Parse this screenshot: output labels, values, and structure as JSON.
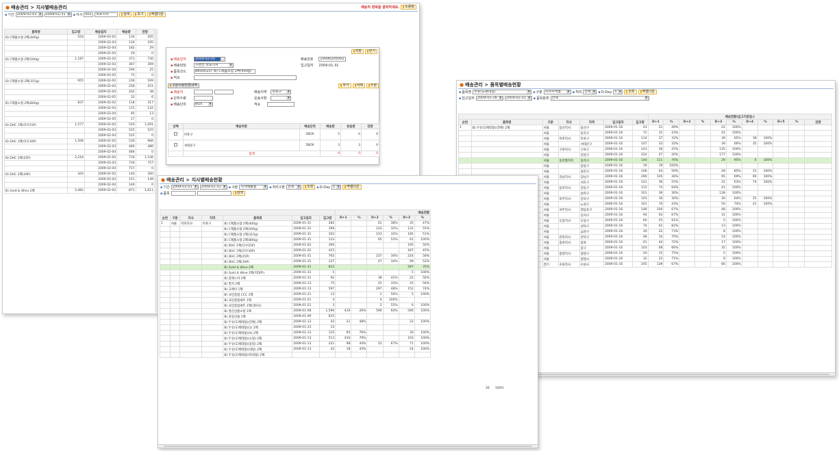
{
  "w1": {
    "title": "배송관리 > 지사별배송관리",
    "notice": "배송처 항목을 클릭하세요.",
    "notice_btn": "도움말",
    "filter_period_label": "기간",
    "date_from": "2009-01-01",
    "date_to": "2009-01-31",
    "branch_label": "지사",
    "branch_code": "001",
    "branch_name": "마포지사",
    "btn_query": "검색",
    "btn_reset": "초기",
    "btn_excel": "엑셀다운",
    "columns": [
      "품목명",
      "입고량",
      "배송일자",
      "배송량",
      "잔량"
    ],
    "rows": [
      [
        "B) C제품소형 2팩(400g)",
        "554",
        "2009-02-02",
        "134",
        "205"
      ],
      [
        "",
        "",
        "2009-02-03",
        "134",
        "105"
      ],
      [
        "",
        "",
        "2009-02-04",
        "182",
        "29"
      ],
      [
        "",
        "",
        "2009-02-05",
        "29",
        "0"
      ],
      [
        "B) C제품소형 2팩(500g)",
        "1,187",
        "2009-02-02",
        "371",
        "736"
      ],
      [
        "",
        "",
        "2009-02-03",
        "367",
        "369"
      ],
      [
        "",
        "",
        "2009-02-04",
        "290",
        "25"
      ],
      [
        "",
        "",
        "2009-02-05",
        "75",
        "0"
      ],
      [
        "B) C제품소형 2팩(315g)",
        "955",
        "2009-02-02",
        "236",
        "509"
      ],
      [
        "",
        "",
        "2009-02-03",
        "258",
        "251"
      ],
      [
        "",
        "",
        "2009-02-04",
        "202",
        "38"
      ],
      [
        "",
        "",
        "2009-02-05",
        "32",
        "6"
      ],
      [
        "B) C제품소형 2팩(800g)",
        "837",
        "2009-02-02",
        "118",
        "317"
      ],
      [
        "",
        "",
        "2009-02-03",
        "115",
        "132"
      ],
      [
        "",
        "",
        "2009-02-04",
        "95",
        "13"
      ],
      [
        "",
        "",
        "2009-02-05",
        "17",
        "0"
      ],
      [
        "B) DHC 1팩(다우25P)",
        "1,577",
        "2009-02-02",
        "520",
        "1,001"
      ],
      [
        "",
        "",
        "2009-02-03",
        "525",
        "525"
      ],
      [
        "",
        "",
        "2009-02-04",
        "525",
        "0"
      ],
      [
        "B) DHC 1팩(다우30P)",
        "1,506",
        "2009-02-02",
        "530",
        "966"
      ],
      [
        "",
        "",
        "2009-02-03",
        "480",
        "486"
      ],
      [
        "",
        "",
        "2009-02-04",
        "486",
        "0"
      ],
      [
        "B) DHC 2팩(25P)",
        "2,216",
        "2009-02-02",
        "730",
        "1,536"
      ],
      [
        "",
        "",
        "2009-02-03",
        "730",
        "757"
      ],
      [
        "",
        "",
        "2009-02-04",
        "757",
        "0"
      ],
      [
        "B) DHC 2팩(30P)",
        "443",
        "2009-02-02",
        "140",
        "300"
      ],
      [
        "",
        "",
        "2009-02-03",
        "151",
        "149"
      ],
      [
        "",
        "",
        "2009-02-04",
        "149",
        "0"
      ],
      [
        "B) Gold & Wine 2팩",
        "2,482",
        "2009-02-02",
        "871",
        "1,611"
      ]
    ]
  },
  "popup": {
    "btn_save": "저장",
    "btn_close": "닫기",
    "label_date": "배송일자",
    "date_value": "2009-02-05",
    "label_manager": "배송담당",
    "manager_value": "구현진 마포지사",
    "label_item": "품목코드",
    "item_value": "B8000107 B) C제품소형 2팩(400g)",
    "label_memo": "적요",
    "label_no": "배송번호",
    "no_value": "20090205002",
    "label_ingo": "입고일자",
    "ingo_value": "2009-01-31",
    "sub_tab": "구분수량변경내역",
    "btn_add": "추가",
    "btn_del": "삭제",
    "btn_mod": "수정",
    "label_shipto": "배송처",
    "label_qty": "단위수량",
    "label_unit": "배송단위",
    "unit_value": "BOX",
    "label_region": "배송지역",
    "region_value": "마포구",
    "label_carrier": "운송사항",
    "label_memo2": "적요",
    "grid_cols": [
      "선택",
      "배송처명",
      "배송단위",
      "배송량",
      "반송량",
      "잔량"
    ],
    "grid_rows": [
      [
        "마포구",
        "5BOX",
        "5",
        "0",
        "0"
      ],
      [
        "서대문구",
        "5BOX",
        "3",
        "3",
        "0"
      ]
    ],
    "total_label": "합계",
    "total_vals": [
      "8",
      "0",
      "0"
    ]
  },
  "w2": {
    "title": "배송관리 > 지사별배송현황",
    "period_label": "기간",
    "date_from": "2009-01-01",
    "date_to": "2009-01-31",
    "kind_label": "구분",
    "kind_value": "지사배송별",
    "etc_label": "처리구분",
    "etc_value": "전체",
    "btn_query": "조회",
    "dday_label": "D-Day",
    "dday_value": "5",
    "btn_excel": "엑셀다운",
    "item_label": "품목",
    "btn_search": "검색",
    "group_header": "배송현황",
    "columns": [
      "순번",
      "구분",
      "지사",
      "지역",
      "품목명",
      "입고일자",
      "입고량",
      "D+1",
      "%",
      "D+2",
      "%",
      "D+3",
      "%"
    ],
    "rows": [
      [
        "1",
        "서울",
        "마포지사",
        "마포구",
        "B) C제품소형 2팩(400g)",
        "2009-01-31",
        "282",
        "",
        "",
        "61",
        "38%",
        "35",
        "47%"
      ],
      [
        "",
        "",
        "",
        "",
        "B) C제품소형 2팩(500g)",
        "2009-01-31",
        "399",
        "",
        "",
        "123",
        "32%",
        "131",
        "55%"
      ],
      [
        "",
        "",
        "",
        "",
        "B) C제품소형 2팩(315g)",
        "2009-01-31",
        "302",
        "",
        "",
        "123",
        "32%",
        "185",
        "51%"
      ],
      [
        "",
        "",
        "",
        "",
        "B) C제품소형 2팩(800g)",
        "2009-01-31",
        "123",
        "",
        "",
        "65",
        "53%",
        "61",
        "100%"
      ],
      [
        "",
        "",
        "",
        "",
        "B) DHC 1팩(다우25P)",
        "2009-01-02",
        "390",
        "",
        "",
        "",
        "",
        "195",
        "50%"
      ],
      [
        "",
        "",
        "",
        "",
        "B) DHC 1팩(다우30P)",
        "2009-01-02",
        "415",
        "",
        "",
        "",
        "",
        "187",
        "45%"
      ],
      [
        "",
        "",
        "",
        "",
        "B) DHC 2팩(25P)",
        "2009-01-31",
        "765",
        "",
        "",
        "237",
        "30%",
        "224",
        "58%"
      ],
      [
        "",
        "",
        "",
        "",
        "B) DHC 2팩(30P)",
        "2009-01-31",
        "137",
        "",
        "",
        "47",
        "34%",
        "99",
        "52%"
      ],
      [
        "",
        "",
        "",
        "",
        "B) Gold & Wine 2팩",
        "2009-01-31",
        "815",
        "",
        "",
        "",
        "",
        "287",
        "35%"
      ],
      [
        "",
        "",
        "",
        "",
        "B) Gold & Wine 2팩(지대추)",
        "2009-01-31",
        "5",
        "",
        "",
        "",
        "",
        "5",
        "100%"
      ],
      [
        "",
        "",
        "",
        "",
        "B) 알래스카 2팩",
        "2009-01-31",
        "92",
        "",
        "",
        "38",
        "41%",
        "22",
        "56%"
      ],
      [
        "",
        "",
        "",
        "",
        "B) 멸치 2팩",
        "2009-01-13",
        "75",
        "",
        "",
        "25",
        "33%",
        "25",
        "56%"
      ],
      [
        "",
        "",
        "",
        "",
        "B) 고메이 1팩",
        "2009-01-13",
        "597",
        "",
        "",
        "297",
        "48%",
        "152",
        "74%"
      ],
      [
        "",
        "",
        "",
        "",
        "B) 국민종합 CCC 1팩",
        "2009-01-21",
        "13",
        "",
        "",
        "1",
        "50%",
        "5",
        "100%"
      ],
      [
        "",
        "",
        "",
        "",
        "B) 국민종합세트 1팩",
        "2009-01-21",
        "4",
        "",
        "",
        "4",
        "100%",
        "",
        ""
      ],
      [
        "",
        "",
        "",
        "",
        "B) 국민종합세트 1팩(대우2)",
        "2009-01-21",
        "3",
        "",
        "",
        "5",
        "55%",
        "6",
        "100%"
      ],
      [
        "",
        "",
        "",
        "",
        "B) 명산상품소형 1팩",
        "2009-01-08",
        "1,596",
        "410",
        "26%",
        "590",
        "64%",
        "590",
        "100%"
      ],
      [
        "",
        "",
        "",
        "",
        "B) 과일선물 1팩",
        "2009-01-09",
        "815",
        "",
        "",
        "",
        "",
        "",
        ""
      ],
      [
        "",
        "",
        "",
        "",
        "B) 두유(도매대형)(전매) 2팩",
        "2009-01-13",
        "42",
        "21",
        "48%",
        "",
        "",
        "22",
        "100%"
      ],
      [
        "",
        "",
        "",
        "",
        "B) 두유(도매대형)(1) 2팩",
        "2009-01-23",
        "15",
        "",
        "",
        "",
        "",
        "",
        ""
      ],
      [
        "",
        "",
        "",
        "",
        "B) 두유(도매대형)(A) 2팩",
        "2009-01-13",
        "125",
        "95",
        "76%",
        "",
        "",
        "30",
        "100%"
      ],
      [
        "",
        "",
        "",
        "",
        "B) 두유(도매대형)(소형) 2팩",
        "2009-01-13",
        "513",
        "410",
        "79%",
        "",
        "",
        "103",
        "100%"
      ],
      [
        "",
        "",
        "",
        "",
        "B) 두유(도매대형)(중형) 2팩",
        "2009-01-13",
        "221",
        "98",
        "44%",
        "52",
        "67%",
        "71",
        "100%"
      ],
      [
        "",
        "",
        "",
        "",
        "B) 두유(도매대형)(대형) 2팩",
        "2009-01-13",
        "42",
        "18",
        "43%",
        "",
        "",
        "24",
        "100%"
      ],
      [
        "",
        "",
        "",
        "",
        "B) 두유(도매대형)(특대형) 2팩",
        "",
        "",
        "",
        "",
        "",
        "",
        "",
        ""
      ]
    ],
    "highlight_row": 8
  },
  "w3": {
    "title": "배송관리 > 품목별배송현황",
    "item_label": "품목명",
    "item_value": "두유(도매대형)",
    "kind_label": "구분",
    "kind_value": "지사지역별",
    "status_label": "처리",
    "status_value": "전체",
    "dday_label": "D-Day",
    "dday_value": "5",
    "btn_query": "조회",
    "btn_excel": "엑셀다운",
    "period_label": "입고일자",
    "date_from": "2009-01-16",
    "date_to": "2009-01-31",
    "type_label": "품목분류",
    "type_value": "전체",
    "group_header": "배송현황(입고기준일:)",
    "columns": [
      "순번",
      "품목명",
      "구분",
      "지사",
      "지역",
      "입고일자",
      "입고량",
      "D+1",
      "%",
      "D+2",
      "%",
      "D+3",
      "%",
      "D+4",
      "%",
      "D+5",
      "%",
      "잔량"
    ],
    "rows": [
      [
        "1",
        "B) 두유(도매대형)(전매) 2팩",
        "서울",
        "용산지사",
        "용산구",
        "2009-01-16",
        "43",
        "21",
        "49%",
        "",
        "",
        "22",
        "100%",
        "",
        "",
        "",
        "",
        ""
      ],
      [
        "",
        "",
        "서울",
        "",
        "동작구",
        "2009-01-16",
        "72",
        "31",
        "43%",
        "",
        "",
        "41",
        "100%",
        "",
        "",
        "",
        "",
        ""
      ],
      [
        "",
        "",
        "서울",
        "마포지사",
        "마포구",
        "2009-01-16",
        "114",
        "37",
        "32%",
        "",
        "",
        "39",
        "65%",
        "38",
        "100%",
        "",
        "",
        ""
      ],
      [
        "",
        "",
        "서울",
        "",
        "서대문구",
        "2009-01-16",
        "107",
        "33",
        "32%",
        "",
        "",
        "39",
        "66%",
        "35",
        "100%",
        "",
        "",
        ""
      ],
      [
        "",
        "",
        "서울",
        "구로지사",
        "구로구",
        "2009-01-16",
        "143",
        "36",
        "25%",
        "",
        "",
        "135",
        "100%",
        "",
        "",
        "",
        "",
        ""
      ],
      [
        "",
        "",
        "서울",
        "",
        "양천구",
        "2009-01-16",
        "224",
        "47",
        "20%",
        "",
        "",
        "177",
        "100%",
        "",
        "",
        "",
        "",
        ""
      ],
      [
        "",
        "",
        "서울",
        "동작월지지",
        "동작구",
        "2009-01-16",
        "140",
        "111",
        "76%",
        "",
        "",
        "29",
        "95%",
        "6",
        "100%",
        "",
        "",
        ""
      ],
      [
        "",
        "",
        "서울",
        "",
        "중랑구",
        "2009-01-16",
        "19",
        "19",
        "100%",
        "",
        "",
        "",
        "",
        "",
        "",
        "",
        "",
        ""
      ],
      [
        "",
        "",
        "서울",
        "",
        "광진구",
        "2009-01-16",
        "106",
        "63",
        "59%",
        "",
        "",
        "28",
        "85%",
        "15",
        "100%",
        "",
        "",
        ""
      ],
      [
        "",
        "",
        "서울",
        "강남지사",
        "강남구",
        "2009-01-16",
        "290",
        "105",
        "36%",
        "",
        "",
        "95",
        "69%",
        "90",
        "100%",
        "",
        "",
        ""
      ],
      [
        "",
        "",
        "서울",
        "",
        "서초구",
        "2009-01-16",
        "141",
        "36",
        "25%",
        "",
        "",
        "31",
        "63%",
        "74",
        "100%",
        "",
        "",
        ""
      ],
      [
        "",
        "",
        "서울",
        "동북지사",
        "강동구",
        "2009-01-16",
        "115",
        "74",
        "64%",
        "",
        "",
        "41",
        "100%",
        "",
        "",
        "",
        "",
        ""
      ],
      [
        "",
        "",
        "서울",
        "",
        "송파구",
        "2009-01-16",
        "161",
        "39",
        "30%",
        "",
        "",
        "138",
        "100%",
        "",
        "",
        "",
        "",
        ""
      ],
      [
        "",
        "",
        "서울",
        "북부지사",
        "강북구",
        "2009-01-16",
        "103",
        "30",
        "30%",
        "",
        "",
        "30",
        "64%",
        "25",
        "100%",
        "",
        "",
        ""
      ],
      [
        "",
        "",
        "서울",
        "",
        "노원구",
        "2009-01-16",
        "161",
        "70",
        "43%",
        "",
        "",
        "50",
        "74%",
        "41",
        "100%",
        "",
        "",
        ""
      ],
      [
        "",
        "",
        "서울",
        "서부지사",
        "영등포구",
        "2009-01-16",
        "148",
        "100",
        "67%",
        "",
        "",
        "48",
        "100%",
        "",
        "",
        "",
        "",
        ""
      ],
      [
        "",
        "",
        "서울",
        "",
        "강서구",
        "2009-01-16",
        "94",
        "63",
        "67%",
        "",
        "",
        "31",
        "100%",
        "",
        "",
        "",
        "",
        ""
      ],
      [
        "",
        "",
        "서울",
        "도봉지사",
        "도봉구",
        "2009-01-16",
        "60",
        "55",
        "91%",
        "",
        "",
        "5",
        "100%",
        "",
        "",
        "",
        "",
        ""
      ],
      [
        "",
        "",
        "서울",
        "",
        "성북구",
        "2009-01-16",
        "74",
        "61",
        "82%",
        "",
        "",
        "13",
        "100%",
        "",
        "",
        "",
        "",
        ""
      ],
      [
        "",
        "",
        "서울",
        "",
        "금천구",
        "2009-01-16",
        "30",
        "22",
        "73%",
        "",
        "",
        "8",
        "100%",
        "",
        "",
        "",
        "",
        ""
      ],
      [
        "",
        "",
        "서울",
        "관악지사",
        "관악구",
        "2009-01-16",
        "48",
        "34",
        "70%",
        "",
        "",
        "14",
        "100%",
        "",
        "",
        "",
        "",
        ""
      ],
      [
        "",
        "",
        "서울",
        "종로지사",
        "종로",
        "2009-01-16",
        "61",
        "44",
        "72%",
        "",
        "",
        "17",
        "100%",
        "",
        "",
        "",
        "",
        ""
      ],
      [
        "",
        "",
        "서울",
        "",
        "중구",
        "2009-01-16",
        "103",
        "68",
        "66%",
        "",
        "",
        "35",
        "100%",
        "",
        "",
        "",
        "",
        ""
      ],
      [
        "",
        "",
        "서울",
        "광명지사",
        "광명구",
        "2009-01-16",
        "20",
        "15",
        "75%",
        "",
        "",
        "5",
        "100%",
        "",
        "",
        "",
        "",
        ""
      ],
      [
        "",
        "",
        "서울",
        "",
        "광명시",
        "2009-01-16",
        "32",
        "23",
        "71%",
        "",
        "",
        "9",
        "100%",
        "",
        "",
        "",
        "",
        ""
      ],
      [
        "",
        "",
        "경기",
        "수원지사",
        "수원시",
        "2009-01-16",
        "205",
        "139",
        "67%",
        "",
        "",
        "66",
        "100%",
        "",
        "",
        "",
        "",
        ""
      ]
    ],
    "highlight_row": 6,
    "stray_vals": [
      "26",
      "100%"
    ]
  }
}
